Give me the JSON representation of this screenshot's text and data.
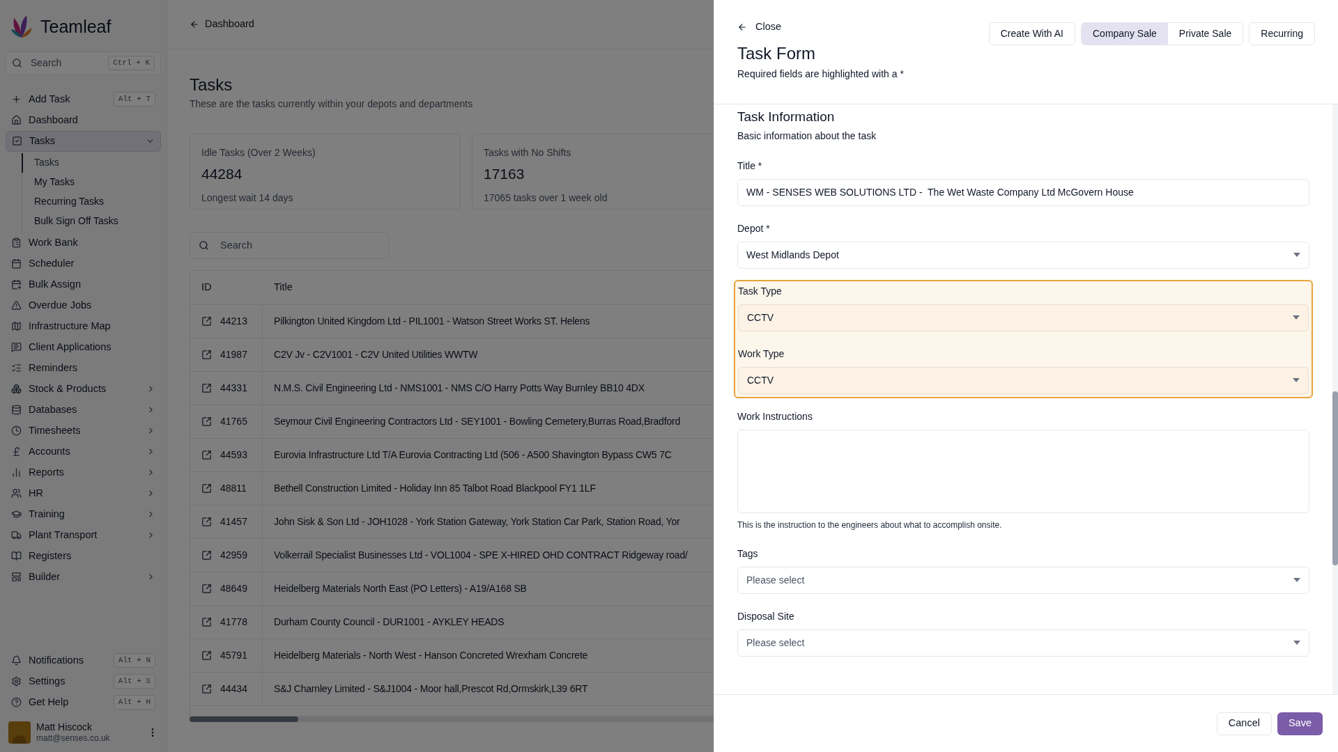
{
  "sidebar": {
    "brand": "Teamleaf",
    "search": {
      "placeholder": "Search",
      "shortcut": "Ctrl + K"
    },
    "items": [
      {
        "label": "Add Task",
        "shortcut": "Alt + T",
        "selected": false
      },
      {
        "label": "Dashboard",
        "selected": false
      },
      {
        "label": "Tasks",
        "selected": true,
        "expanded": true,
        "children": [
          {
            "label": "Tasks",
            "selected": true
          },
          {
            "label": "My Tasks",
            "selected": false
          },
          {
            "label": "Recurring Tasks",
            "selected": false
          },
          {
            "label": "Bulk Sign Off Tasks",
            "selected": false
          }
        ]
      },
      {
        "label": "Work Bank",
        "selected": false
      },
      {
        "label": "Scheduler",
        "selected": false
      },
      {
        "label": "Bulk Assign",
        "selected": false
      },
      {
        "label": "Overdue Jobs",
        "selected": false
      },
      {
        "label": "Infrastructure Map",
        "selected": false
      },
      {
        "label": "Client Applications",
        "selected": false
      },
      {
        "label": "Reminders",
        "selected": false
      },
      {
        "label": "Stock & Products",
        "selected": false,
        "expanded": false
      },
      {
        "label": "Databases",
        "selected": false,
        "expanded": false
      },
      {
        "label": "Timesheets",
        "selected": false,
        "expanded": false
      },
      {
        "label": "Accounts",
        "selected": false,
        "expanded": false
      },
      {
        "label": "Reports",
        "selected": false,
        "expanded": false
      },
      {
        "label": "HR",
        "selected": false,
        "expanded": false
      },
      {
        "label": "Training",
        "selected": false,
        "expanded": false
      },
      {
        "label": "Plant Transport",
        "selected": false,
        "expanded": false
      },
      {
        "label": "Registers",
        "selected": false
      },
      {
        "label": "Builder",
        "selected": false,
        "expanded": false
      }
    ],
    "bottom_items": [
      {
        "label": "Notifications",
        "shortcut": "Alt + N"
      },
      {
        "label": "Settings",
        "shortcut": "Alt + S"
      },
      {
        "label": "Get Help",
        "shortcut": "Alt + H"
      }
    ],
    "user": {
      "name": "Matt Hiscock",
      "email": "matt@senses.co.uk"
    }
  },
  "main": {
    "breadcrumb": "Dashboard",
    "title": "Tasks",
    "subtitle": "These are the tasks currently within your depots and departments",
    "stats": [
      {
        "label": "Idle Tasks (Over 2 Weeks)",
        "value": "44284",
        "note": "Longest wait 14 days"
      },
      {
        "label": "Tasks with No Shifts",
        "value": "17163",
        "note": "17065 tasks over 1 week old"
      }
    ],
    "search": {
      "placeholder": "Search"
    },
    "table": {
      "columns": [
        "ID",
        "Title"
      ],
      "rows": [
        {
          "id": "44213",
          "title": "Pilkington United Kingdom Ltd - PIL1001 - Watson Street Works ST. Helens"
        },
        {
          "id": "41987",
          "title": "C2V Jv - C2V1001 - C2V United Utilities WWTW"
        },
        {
          "id": "44331",
          "title": "N.M.S. Civil Engineering Ltd - NMS1001 - NMS C/O Harry Potts Way Burnley BB10 4DX"
        },
        {
          "id": "41765",
          "title": "Seymour Civil Engineering Contractors Ltd - SEY1001 - Bowling Cemetery,Burras Road,Bradford"
        },
        {
          "id": "44593",
          "title": "Eurovia Infrastructure Ltd T/A Eurovia Contracting Ltd (506 - A500 Shavington Bypass CW5 7C"
        },
        {
          "id": "48811",
          "title": "Bethell Construction Limited - Holiday Inn 85 Talbot Road Blackpool FY1 1LF"
        },
        {
          "id": "41457",
          "title": "John Sisk & Son Ltd - JOH1028 - York Station Gateway, York Station Car Park, Station Road, Yor"
        },
        {
          "id": "42959",
          "title": "Volkerrail Specialist Businesses Ltd - VOL1004 - SPE X-HIRED OHD CONTRACT Ridgeway road/"
        },
        {
          "id": "48649",
          "title": "Heidelberg Materials North East (PO Letters) - A19/A168 SB"
        },
        {
          "id": "41778",
          "title": "Durham County Council - DUR1001 - AYKLEY HEADS"
        },
        {
          "id": "45791",
          "title": "Heidelberg Materials - North West - Hanson Concreted Wrexham Concrete"
        },
        {
          "id": "44434",
          "title": "S&J Charnley Limited - S&J1004 - Moor hall,Prescot Rd,Ormskirk,L39 6RT"
        }
      ]
    }
  },
  "panel": {
    "close": "Close",
    "title": "Task Form",
    "subtitle": "Required fields are highlighted with a *",
    "header_actions": [
      {
        "kind": "button",
        "label": "Create With AI"
      },
      {
        "kind": "segmented",
        "options": [
          {
            "label": "Company Sale",
            "selected": true
          },
          {
            "label": "Private Sale",
            "selected": false
          }
        ]
      },
      {
        "kind": "button",
        "label": "Recurring"
      }
    ],
    "section": {
      "title": "Task Information",
      "description": "Basic information about the task"
    },
    "fields": [
      {
        "kind": "text",
        "label": "Title *",
        "value": "WM - SENSES WEB SOLUTIONS LTD -  The Wet Waste Company Ltd McGovern House",
        "highlighted": false
      },
      {
        "kind": "select",
        "label": "Depot *",
        "value": "West Midlands Depot",
        "highlighted": false
      },
      {
        "kind": "select",
        "label": "Task Type",
        "value": "CCTV",
        "highlighted": true
      },
      {
        "kind": "select",
        "label": "Work Type",
        "value": "CCTV",
        "highlighted": true
      },
      {
        "kind": "textarea",
        "label": "Work Instructions",
        "hint": "This is the instruction to the engineers about what to accomplish onsite.",
        "highlighted": false
      },
      {
        "kind": "select",
        "label": "Tags",
        "placeholder": "Please select",
        "highlighted": false
      },
      {
        "kind": "select",
        "label": "Disposal Site",
        "placeholder": "Please select",
        "highlighted": false
      }
    ],
    "footer": [
      {
        "kind": "secondary",
        "label": "Cancel"
      },
      {
        "kind": "primary",
        "label": "Save"
      }
    ]
  }
}
